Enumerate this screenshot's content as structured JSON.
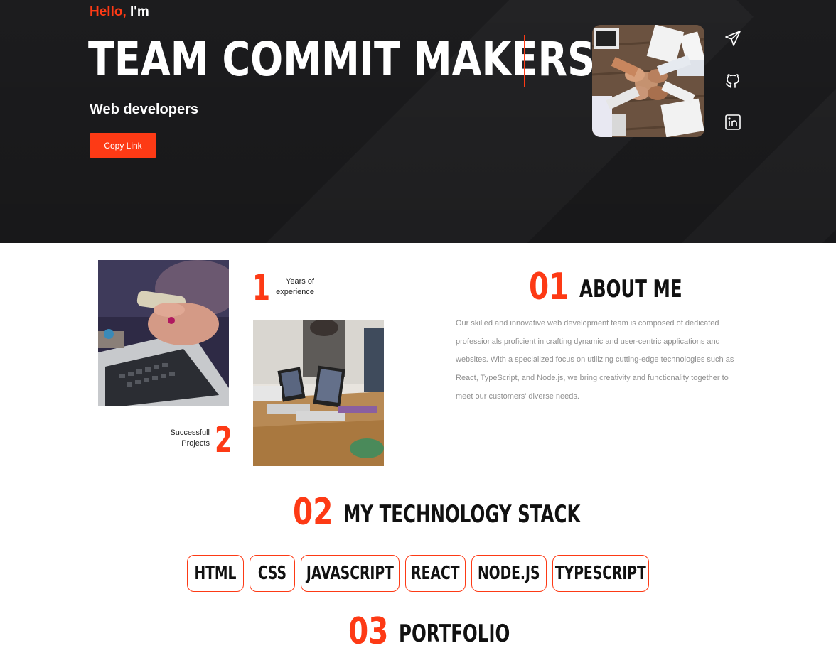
{
  "hero": {
    "hello": "Hello,",
    "im": "I'm",
    "title": "TEAM COMMIT MAKERS",
    "subtitle": "Web developers",
    "copy_button": "Copy Link",
    "social_icons": [
      "send-icon",
      "github-icon",
      "linkedin-icon"
    ]
  },
  "about": {
    "stat1_number": "1",
    "stat1_label_line1": "Years of",
    "stat1_label_line2": "experience",
    "stat2_number": "2",
    "stat2_label_line1": "Successfull",
    "stat2_label_line2": "Projects",
    "section_number": "01",
    "section_title": "ABOUT ME",
    "text": "Our skilled and innovative web development team is composed of dedicated professionals proficient in crafting dynamic and user-centric applications and websites. With a specialized focus on utilizing cutting-edge technologies such as React, TypeScript, and Node.js, we bring creativity and functionality together to meet our customers' diverse needs."
  },
  "stack": {
    "section_number": "02",
    "section_title": "MY TECHNOLOGY STACK",
    "items": [
      "HTML",
      "CSS",
      "JAVASCRIPT",
      "REACT",
      "NODE.JS",
      "TYPESCRIPT"
    ]
  },
  "portfolio": {
    "section_number": "03",
    "section_title": "PORTFOLIO"
  },
  "colors": {
    "accent": "#fd3a15",
    "hero_bg": "#1c1c1e",
    "text_dark": "#111111",
    "text_muted": "#8f8f8f"
  }
}
